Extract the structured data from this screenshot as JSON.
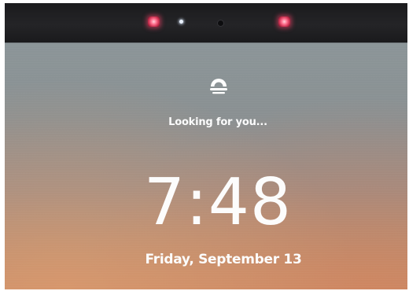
{
  "lock_screen": {
    "status_text": "Looking for you...",
    "time": "7:48",
    "date": "Friday, September 13"
  },
  "icons": {
    "windows_hello": "windows-hello-face-icon",
    "camera_lens": "camera-lens-icon",
    "camera_light": "camera-light-icon",
    "ir_emitter": "ir-emitter-icon"
  },
  "colors": {
    "text": "#fcfcfc",
    "ir_emitter": "#ff6f8d",
    "screen_top": "#8b9598",
    "screen_bottom": "#c58c6a"
  }
}
